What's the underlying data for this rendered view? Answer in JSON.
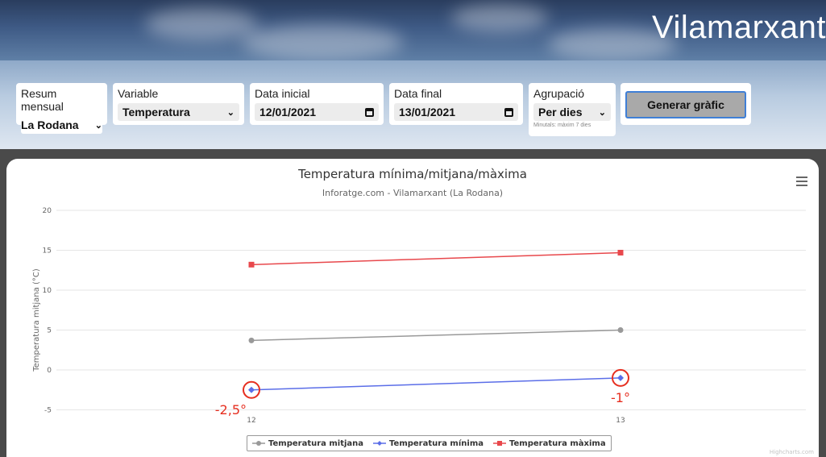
{
  "site_title": "Vilamarxant",
  "controls": {
    "station": {
      "label": "Resum mensual",
      "value": "La Rodana"
    },
    "variable": {
      "label": "Variable",
      "value": "Temperatura"
    },
    "start_date": {
      "label": "Data inicial",
      "value": "12/01/2021"
    },
    "end_date": {
      "label": "Data final",
      "value": "13/01/2021"
    },
    "grouping": {
      "label": "Agrupació",
      "value": "Per dies",
      "hint": "Minutals: màxim 7 dies"
    },
    "generate_label": "Generar gràfic"
  },
  "chart_data": {
    "type": "line",
    "title": "Temperatura mínima/mitjana/màxima",
    "subtitle": "Inforatge.com - Vilamarxant (La Rodana)",
    "ylabel": "Temperatura mitjana (°C)",
    "categories": [
      "12",
      "13"
    ],
    "yticks": [
      "20",
      "15",
      "10",
      "5",
      "0",
      "-5"
    ],
    "ylim": [
      -7,
      20
    ],
    "grid": true,
    "legend_position": "bottom",
    "series": [
      {
        "name": "Temperatura mitjana",
        "values": [
          3.7,
          5.0
        ],
        "color": "#999999",
        "marker": "circle"
      },
      {
        "name": "Temperatura mínima",
        "values": [
          -2.5,
          -1.0
        ],
        "color": "#5b6ee8",
        "marker": "diamond"
      },
      {
        "name": "Temperatura màxima",
        "values": [
          13.2,
          14.7
        ],
        "color": "#e8484c",
        "marker": "square"
      }
    ],
    "annotations": [
      {
        "text": "-2,5°",
        "x": "12",
        "y": -2.5,
        "color": "#e62e1f"
      },
      {
        "text": "-1°",
        "x": "13",
        "y": -1.0,
        "color": "#e62e1f"
      }
    ],
    "credits": "Highcharts.com"
  }
}
